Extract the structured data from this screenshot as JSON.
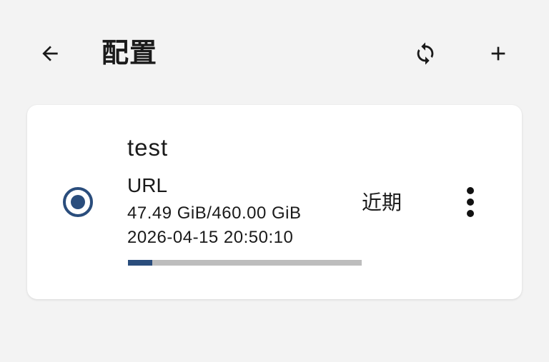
{
  "header": {
    "title": "配置",
    "back_icon": "arrow-left-icon",
    "sync_icon": "sync-icon",
    "add_icon": "plus-icon"
  },
  "profile": {
    "name": "test",
    "type": "URL",
    "usage": "47.49 GiB/460.00 GiB",
    "usage_fraction": 0.103,
    "expire": "2026-04-15 20:50:10",
    "update_label": "近期",
    "selected": true
  },
  "colors": {
    "accent": "#2a4d7c",
    "track": "#bdbdbd",
    "background": "#f3f3f3",
    "card": "#ffffff"
  }
}
